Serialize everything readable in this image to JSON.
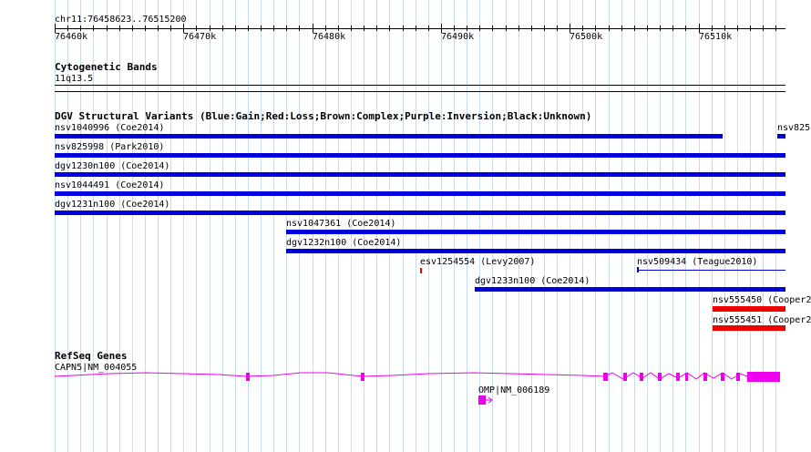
{
  "ruler": {
    "range_label": "chr11:76458623..76515200",
    "ticks": [
      "76460k",
      "76470k",
      "76480k",
      "76490k",
      "76500k",
      "76510k"
    ]
  },
  "cyto": {
    "title": "Cytogenetic Bands",
    "band": "11q13.5"
  },
  "dgv": {
    "title": "DGV Structural Variants (Blue:Gain;Red:Loss;Brown:Complex;Purple:Inversion;Black:Unknown)",
    "gain_color": "#0000dd",
    "loss_color": "#ee0000",
    "variants": [
      {
        "label": "nsv1040996 (Coe2014)",
        "type": "gain"
      },
      {
        "label": "nsv825",
        "type": "gain"
      },
      {
        "label": "nsv825998 (Park2010)",
        "type": "gain"
      },
      {
        "label": "dgv1230n100 (Coe2014)",
        "type": "gain"
      },
      {
        "label": "nsv1044491 (Coe2014)",
        "type": "gain"
      },
      {
        "label": "dgv1231n100 (Coe2014)",
        "type": "gain"
      },
      {
        "label": "nsv1047361 (Coe2014)",
        "type": "gain"
      },
      {
        "label": "dgv1232n100 (Coe2014)",
        "type": "gain"
      },
      {
        "label": "esv1254554 (Levy2007)",
        "type": "loss"
      },
      {
        "label": "nsv509434 (Teague2010)",
        "type": "gain"
      },
      {
        "label": "dgv1233n100 (Coe2014)",
        "type": "gain"
      },
      {
        "label": "nsv555450 (Cooper2",
        "type": "loss"
      },
      {
        "label": "nsv555451 (Cooper2",
        "type": "loss"
      }
    ]
  },
  "refseq": {
    "title": "RefSeq Genes",
    "gene_color": "#ee00ee",
    "genes": [
      {
        "label": "CAPN5|NM_004055"
      },
      {
        "label": "OMP|NM_006189"
      }
    ]
  }
}
